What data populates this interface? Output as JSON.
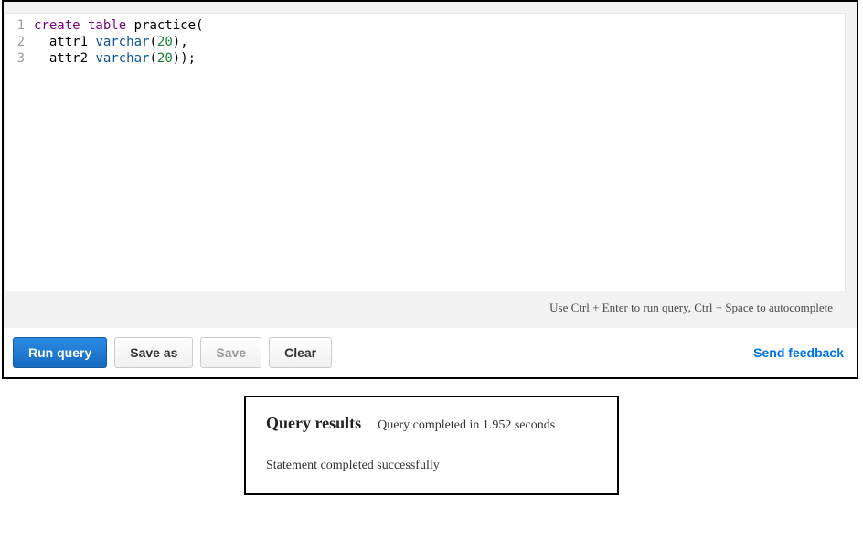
{
  "editor": {
    "lines": [
      {
        "n": "1",
        "segments": [
          {
            "t": "create table",
            "cls": "tok-keyword"
          },
          {
            "t": " practice",
            "cls": "tok-ident"
          },
          {
            "t": "(",
            "cls": "tok-punct"
          }
        ]
      },
      {
        "n": "2",
        "segments": [
          {
            "t": "  attr1 ",
            "cls": "tok-ident"
          },
          {
            "t": "varchar",
            "cls": "tok-type"
          },
          {
            "t": "(",
            "cls": "tok-punct"
          },
          {
            "t": "20",
            "cls": "tok-num"
          },
          {
            "t": ")",
            "cls": "tok-punct"
          },
          {
            "t": ",",
            "cls": "tok-punct"
          }
        ]
      },
      {
        "n": "3",
        "segments": [
          {
            "t": "  attr2 ",
            "cls": "tok-ident"
          },
          {
            "t": "varchar",
            "cls": "tok-type"
          },
          {
            "t": "(",
            "cls": "tok-punct"
          },
          {
            "t": "20",
            "cls": "tok-num"
          },
          {
            "t": ")",
            "cls": "tok-punct"
          },
          {
            "t": ")",
            "cls": "tok-punct"
          },
          {
            "t": ";",
            "cls": "tok-punct"
          }
        ]
      }
    ],
    "hint": "Use Ctrl + Enter to run query, Ctrl + Space to autocomplete"
  },
  "toolbar": {
    "run": "Run query",
    "save_as": "Save as",
    "save": "Save",
    "clear": "Clear",
    "feedback": "Send feedback"
  },
  "results": {
    "title": "Query results",
    "meta": "Query completed in 1.952 seconds",
    "status": "Statement completed successfully"
  }
}
